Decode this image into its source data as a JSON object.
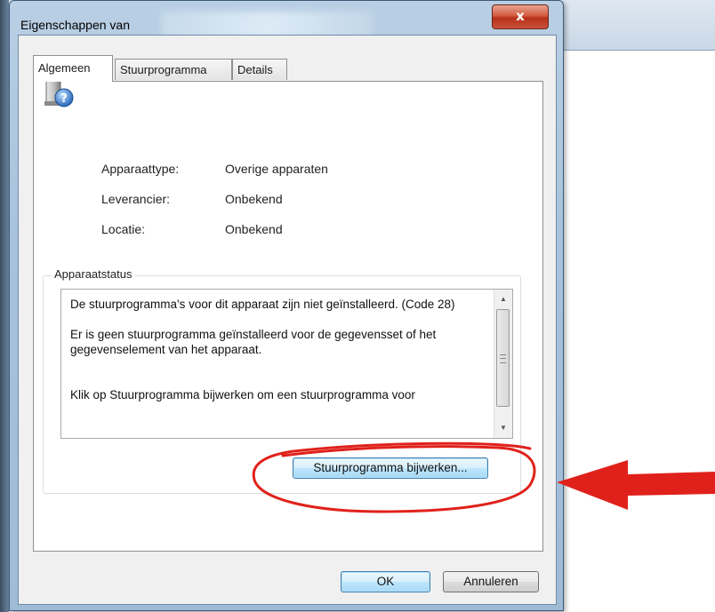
{
  "dialog": {
    "title": "Eigenschappen van",
    "close_label": "x"
  },
  "tabs": [
    {
      "label": "Algemeen",
      "active": true
    },
    {
      "label": "Stuurprogramma",
      "active": false
    },
    {
      "label": "Details",
      "active": false
    }
  ],
  "device": {
    "icon": "unknown-device-icon",
    "properties": [
      {
        "label": "Apparaattype:",
        "value": "Overige apparaten"
      },
      {
        "label": "Leverancier:",
        "value": "Onbekend"
      },
      {
        "label": "Locatie:",
        "value": "Onbekend"
      }
    ]
  },
  "status": {
    "group_title": "Apparaatstatus",
    "paragraphs": [
      "De stuurprogramma's voor dit apparaat zijn niet geïnstalleerd. (Code 28)",
      "Er is geen stuurprogramma geïnstalleerd voor de gegevensset of het gegevenselement van het apparaat.",
      "Klik op Stuurprogramma bijwerken om een stuurprogramma voor"
    ],
    "update_button": "Stuurprogramma bijwerken..."
  },
  "footer": {
    "ok_label": "OK",
    "cancel_label": "Annuleren"
  },
  "annotation": {
    "color": "#e0211b"
  }
}
